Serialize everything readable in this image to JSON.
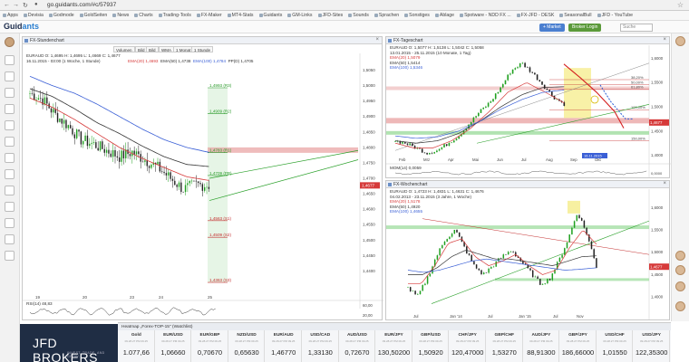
{
  "browser": {
    "url": "go.guidants.com/#c/57937",
    "bookmarks": [
      "Apps",
      "Devisia",
      "Godmode",
      "GoldSeiten",
      "News",
      "Charts",
      "Trading-Tools",
      "FX-Maker",
      "MT4-Stats",
      "Guidants",
      "GM-Links",
      "JFD-Sites",
      "Sounds",
      "Sprachen",
      "Sonstiges",
      "Ablage",
      "Spotware - NDD FX ...",
      "FX-JFD - DESK",
      "SeasonalBull",
      "JFD - YouTube"
    ]
  },
  "app": {
    "logo_main": "Guid",
    "logo_accent": "ants",
    "search_placeholder": "Suche",
    "header_buttons": {
      "market": "+ Market",
      "broker_login": "Broker Login"
    }
  },
  "colors": {
    "ema20": "#d63a3a",
    "ema50": "#333333",
    "ema100": "#3a5fd6",
    "candle_up": "#1fa01f",
    "candle_down": "#222222",
    "zone_red": "#e8a0a0",
    "zone_green": "#9edc9e",
    "zone_yellow": "#f5ec8a",
    "trend_green": "#2aa02a",
    "arrow_red": "#d42020",
    "arrow_blue": "#2a5fd6",
    "ticker_bg": "#1f2d44"
  },
  "panel_hourly": {
    "title": "FX-Stundenchart",
    "toolbar": [
      "Volumen",
      "Bild",
      "Bild",
      "WMA",
      "1 Monat",
      "1 Stunde"
    ],
    "legend": {
      "symbol": "EURAUD  O: 1,4695  H: 1,4695  L: 1,4669  C: 1,4677",
      "date": "16.11.2015 - 03:00 (1 Woche, 1 Stunde)",
      "ema20": "EMA(20)  1,4693",
      "ema50": "EMA(50)  1,4738",
      "ema100": "EMA(100)  1,4784",
      "ppo": "PP(D)  1,4705"
    },
    "levels": [
      {
        "label": "1,4993 (R3)",
        "value": 1.4993
      },
      {
        "label": "1,4909 (R2)",
        "value": 1.4909
      },
      {
        "label": "1,4783 (R1)",
        "value": 1.4783
      },
      {
        "label": "1,4709 (PP)",
        "value": 1.4709
      },
      {
        "label": "1,4563 (S1)",
        "value": 1.4563
      },
      {
        "label": "1,4509 (S2)",
        "value": 1.4509
      },
      {
        "label": "1,4363 (S3)",
        "value": 1.4363
      }
    ],
    "y_ticks": [
      "1,5050",
      "1,5000",
      "1,4950",
      "1,4900",
      "1,4850",
      "1,4800",
      "1,4750",
      "1,4700",
      "1,4650",
      "1,4600",
      "1,4550",
      "1,4500",
      "1,4450",
      "1,4400"
    ],
    "current_price": "1,4677",
    "x_ticks": [
      "19",
      "20",
      "23",
      "24",
      "25"
    ],
    "rsi_legend": "RSI(14)  48,83",
    "rsi_ticks": [
      "60,00",
      "20,00"
    ]
  },
  "panel_daily": {
    "title": "FX-Tageschart",
    "legend": {
      "symbol": "EURAUD  O: 1,5077  H: 1,5138  L: 1,5042  C: 1,5058",
      "date": "13.01.2015 - 25.11.2015 (10 Monate, 1 Tag)",
      "ema20": "EMA(20)  1,5079",
      "ema50": "EMA(50)  1,5414",
      "ema100": "EMA(100)  1,5346"
    },
    "fib_labels": [
      "38,20%",
      "50,00%",
      "61,80%",
      "100,00%",
      "150,00%"
    ],
    "y_ticks": [
      "1,6000",
      "1,5500",
      "1,5000",
      "1,4500",
      "1,4000"
    ],
    "current_price": "1,4677",
    "x_ticks": [
      "Feb",
      "Mrz",
      "Apr",
      "Mai",
      "Jun",
      "Jul",
      "Aug",
      "Sep",
      "Okt"
    ],
    "date_marker": "16.11.2015",
    "mom_legend": "MOM(14)  0,0059",
    "mom_tick": "0,0000"
  },
  "panel_weekly": {
    "title": "FX-Wochenchart",
    "legend": {
      "symbol": "EURAUD  O: 1,4723  H: 1,4831  L: 1,4631  C: 1,4676",
      "date": "04.02.2013 - 23.11.2015 (3 Jahre, 1 Woche)",
      "ema20": "EMA(20)  1,5178",
      "ema50": "EMA(50)  1,4920",
      "ema100": "EMA(100)  1,4655"
    },
    "y_ticks": [
      "1,6000",
      "1,5500",
      "1,5000",
      "1,4500",
      "1,4000"
    ],
    "current_price": "1,4677",
    "x_ticks": [
      "Jul",
      "Jan '14",
      "Jul",
      "Jan '15",
      "Jul",
      "Nov"
    ]
  },
  "watchlist": {
    "title": "Heatmap „Forex-TOP-15\" (Watchlist)",
    "brand_main": "JFD",
    "brand_sub": "BROKERS",
    "brand_tagline": "INVEST. TRADE. AND GROW.",
    "tickers": [
      {
        "name": "Gold",
        "sub": "09.28.27  PM 09.25",
        "price": "1.077,66"
      },
      {
        "name": "EUR/USD",
        "sub": "09.28.27  PM 09.25",
        "price": "1,06660"
      },
      {
        "name": "EUR/GBP",
        "sub": "09.28.27  PM 09.25",
        "price": "0,70670"
      },
      {
        "name": "NZD/USD",
        "sub": "09.28.27  PM 09.25",
        "price": "0,65630"
      },
      {
        "name": "EUR/AUD",
        "sub": "09.28.27  PM 09.25",
        "price": "1,46770"
      },
      {
        "name": "USD/CAD",
        "sub": "09.28.27  PM 09.25",
        "price": "1,33130"
      },
      {
        "name": "AUD/USD",
        "sub": "09.28.27  PM 09.25",
        "price": "0,72670"
      },
      {
        "name": "EUR/JPY",
        "sub": "09.28.27  PM 09.25",
        "price": "130,50200"
      },
      {
        "name": "GBP/USD",
        "sub": "09.28.27  PM 09.25",
        "price": "1,50920"
      },
      {
        "name": "CHF/JPY",
        "sub": "09.28.27  PM 09.25",
        "price": "120,47000"
      },
      {
        "name": "GBP/CHF",
        "sub": "09.28.27  PM 09.25",
        "price": "1,53270"
      },
      {
        "name": "AUD/JPY",
        "sub": "09.28.27  PM 09.25",
        "price": "88,91300"
      },
      {
        "name": "GBP/JPY",
        "sub": "09.28.27  PM 09.25",
        "price": "186,66000"
      },
      {
        "name": "USD/CHF",
        "sub": "09.28.27  PM 09.25",
        "price": "1,01550"
      },
      {
        "name": "USD/JPY",
        "sub": "09.28.27  PM 09.25",
        "price": "122,35300"
      }
    ]
  }
}
